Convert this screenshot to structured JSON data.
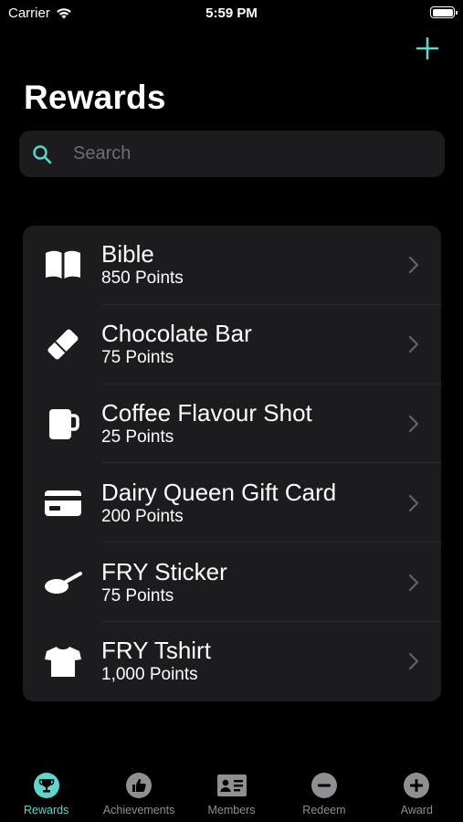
{
  "status_bar": {
    "carrier": "Carrier",
    "time": "5:59 PM"
  },
  "header": {
    "title": "Rewards",
    "add_icon": "plus-icon"
  },
  "search": {
    "placeholder": "Search",
    "value": "",
    "icon": "search-icon"
  },
  "rewards": [
    {
      "name": "Bible",
      "points": "850 Points",
      "icon": "book-icon"
    },
    {
      "name": "Chocolate Bar",
      "points": "75 Points",
      "icon": "eraser-icon"
    },
    {
      "name": "Coffee Flavour Shot",
      "points": "25 Points",
      "icon": "mug-icon"
    },
    {
      "name": "Dairy Queen Gift Card",
      "points": "200 Points",
      "icon": "credit-card-icon"
    },
    {
      "name": "FRY Sticker",
      "points": "75 Points",
      "icon": "frying-pan-icon"
    },
    {
      "name": "FRY Tshirt",
      "points": "1,000 Points",
      "icon": "tshirt-icon"
    }
  ],
  "tabs": [
    {
      "label": "Rewards",
      "icon": "trophy-icon",
      "active": true
    },
    {
      "label": "Achievements",
      "icon": "thumbs-up-icon",
      "active": false
    },
    {
      "label": "Members",
      "icon": "id-card-icon",
      "active": false
    },
    {
      "label": "Redeem",
      "icon": "minus-circle-icon",
      "active": false
    },
    {
      "label": "Award",
      "icon": "plus-circle-icon",
      "active": false
    }
  ],
  "colors": {
    "accent": "#5fd6cc",
    "background": "#000000",
    "card": "#1c1c1e",
    "inactive": "#8e8e93"
  }
}
